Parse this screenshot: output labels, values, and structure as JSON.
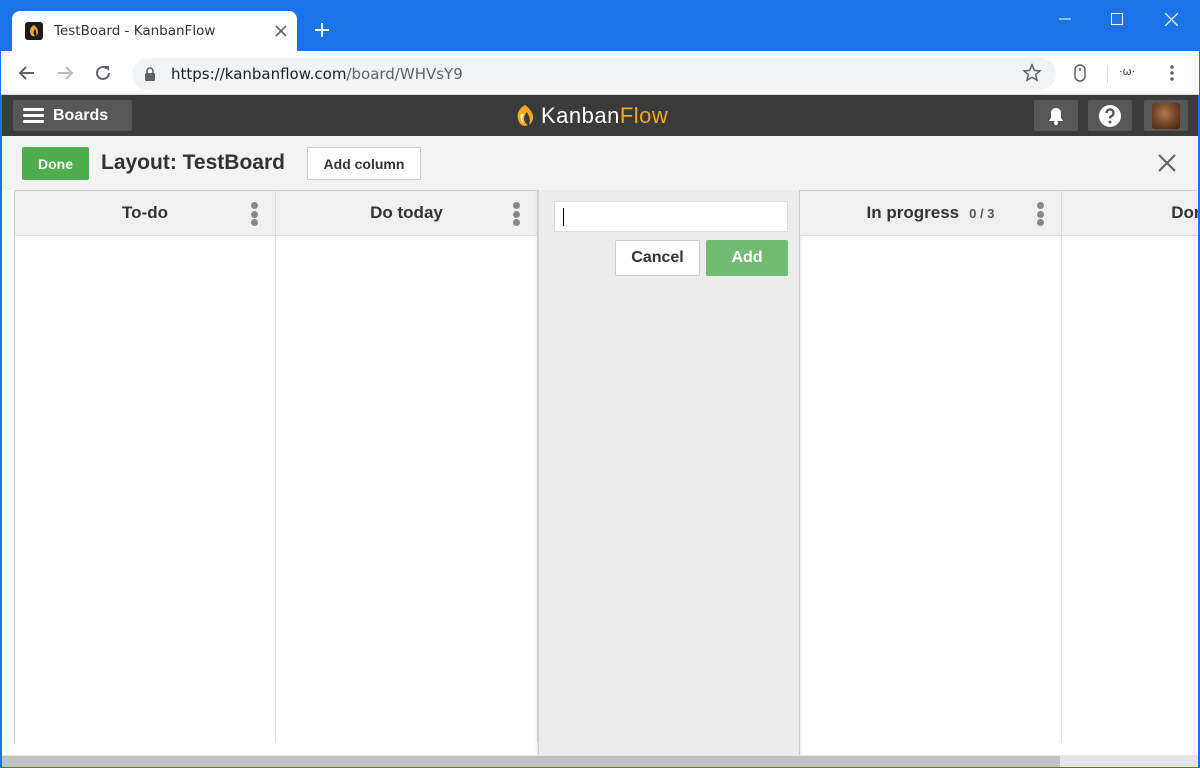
{
  "browser": {
    "tab": {
      "title": "TestBoard - KanbanFlow",
      "favicon": "kanbanflow-logo-icon"
    },
    "new_tab_label": "+",
    "url": {
      "host": "https://kanbanflow.com",
      "path": "/board/WHVsY9"
    },
    "extension_text": "·ω·",
    "accent_color": "#1a73e8"
  },
  "header": {
    "boards_label": "Boards",
    "brand": {
      "part1": "Kanban",
      "part2": "Flow"
    },
    "brand_color": "#f5a623"
  },
  "layoutbar": {
    "done_label": "Done",
    "title": "Layout: TestBoard",
    "add_column_label": "Add column"
  },
  "columns": [
    {
      "name": "To-do",
      "limit": ""
    },
    {
      "name": "Do today",
      "limit": ""
    },
    {
      "name": "In progress",
      "limit": "0 / 3"
    },
    {
      "name": "Done",
      "limit": ""
    }
  ],
  "new_column_form": {
    "input_value": "",
    "cancel_label": "Cancel",
    "add_label": "Add"
  }
}
